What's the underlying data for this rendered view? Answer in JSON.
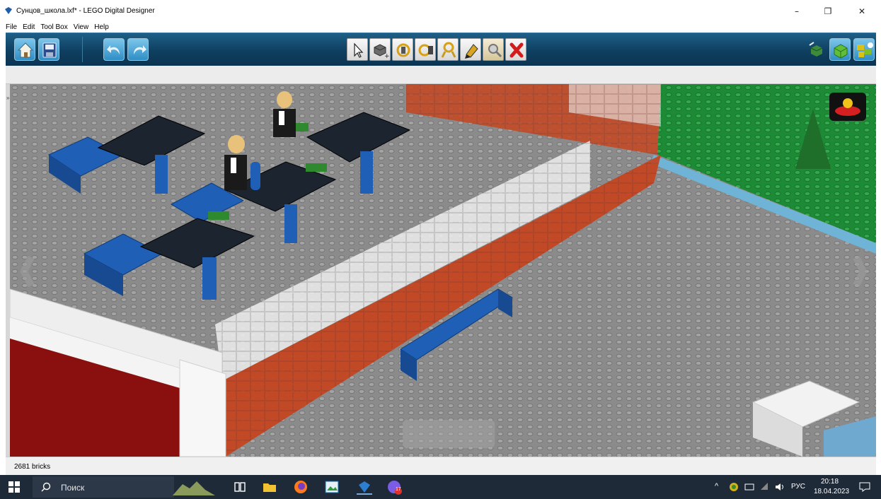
{
  "window": {
    "title": "Сунцов_школа.lxf* - LEGO Digital Designer",
    "minimize_glyph": "–",
    "restore_glyph": "❐",
    "close_glyph": "✕"
  },
  "menu": [
    "File",
    "Edit",
    "Tool Box",
    "View",
    "Help"
  ],
  "toolbar": {
    "left_buttons": [
      "home-icon",
      "save-icon",
      "undo-icon",
      "redo-icon"
    ],
    "tools": [
      "select-tool-icon",
      "clone-tool-icon",
      "hinge-tool-icon",
      "hinge-align-tool-icon",
      "flex-tool-icon",
      "paint-tool-icon",
      "hide-tool-icon",
      "delete-tool-icon"
    ],
    "active_tool": "hide-tool-icon",
    "mode_buttons": [
      "build-mode-icon",
      "view-mode-icon",
      "instructions-mode-icon"
    ]
  },
  "status": {
    "brick_count": "2681 bricks"
  },
  "taskbar": {
    "search_placeholder": "Поиск",
    "language": "РУС",
    "time": "20:18",
    "date": "18.04.2023",
    "notification_badge": "17"
  },
  "colors": {
    "toolbar_blue": "#0f3f60",
    "baseplate_gray": "#8a8a8a",
    "brick_blue": "#1f5fb5",
    "brick_black": "#1c2430",
    "brick_red": "#b52a12",
    "grass_green": "#1f8f3a",
    "taskbar": "#1f2a38"
  }
}
